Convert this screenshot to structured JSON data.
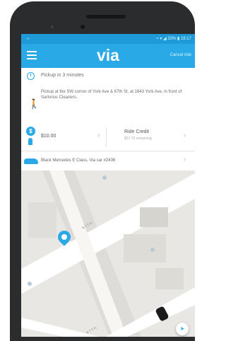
{
  "status_bar": {
    "right": "≈ ▾ ◢ 33% ▮ 18:17"
  },
  "app": {
    "logo": "via",
    "cancel_label": "Cancel ride"
  },
  "pickup": {
    "time": "Pickup in 3 minutes",
    "description": "Pickup at the SW corner of York Ave & 67th St, at 1643 York Ave, in front of Sartorius Cleaners."
  },
  "payment": {
    "amount": "$10.00",
    "credit_label": "Ride Credit",
    "credit_remaining": "$27.70 remaining"
  },
  "vehicle": {
    "description": "Black Mercedes E Class, Via car #2436"
  },
  "map": {
    "street_label_1": "67TH",
    "street_label_2": "67TH"
  },
  "icons": {
    "menu": "menu-icon",
    "clock": "clock-icon",
    "walk": "walking-person-icon",
    "dollar": "dollar-icon",
    "car": "car-icon",
    "locate": "locate-icon"
  },
  "colors": {
    "accent": "#29a9e6",
    "status_bar": "#1f9ad8",
    "phone_body": "#2a2c2e"
  }
}
